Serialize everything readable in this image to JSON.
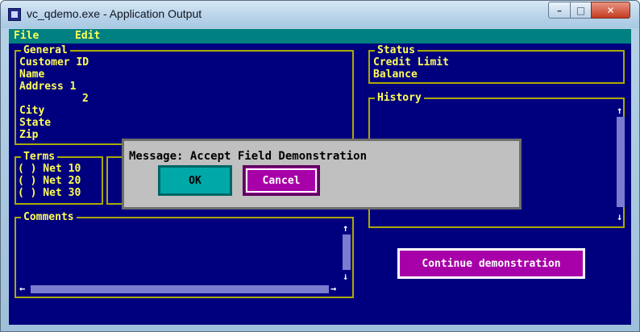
{
  "window": {
    "title": "vc_qdemo.exe - Application Output",
    "controls": {
      "minimize": "–",
      "maximize": "□",
      "close": "✕"
    }
  },
  "menu": {
    "items": [
      "File",
      "Edit"
    ]
  },
  "general": {
    "title": "General",
    "fields": [
      "Customer ID",
      "Name",
      "Address 1",
      "2",
      "City",
      "State",
      "Zip"
    ]
  },
  "status": {
    "title": "Status",
    "fields": [
      "Credit Limit",
      "Balance"
    ]
  },
  "history": {
    "title": "History"
  },
  "terms": {
    "title": "Terms",
    "options": [
      "( ) Net 10",
      "( ) Net 20",
      "( ) Net 30"
    ]
  },
  "comments": {
    "title": "Comments"
  },
  "dialog": {
    "message": "Message: Accept Field Demonstration",
    "ok_label": "OK",
    "cancel_label": "Cancel"
  },
  "continue_label": "Continue demonstration",
  "arrows": {
    "up": "↑",
    "down": "↓",
    "left": "←",
    "right": "→"
  },
  "colors": {
    "console_bg": "#00007f",
    "menubar_bg": "#008080",
    "text": "#ffff55",
    "ok_button": "#00a8a8",
    "cancel_button": "#a800a8",
    "dialog_bg": "#c0c0c0"
  }
}
